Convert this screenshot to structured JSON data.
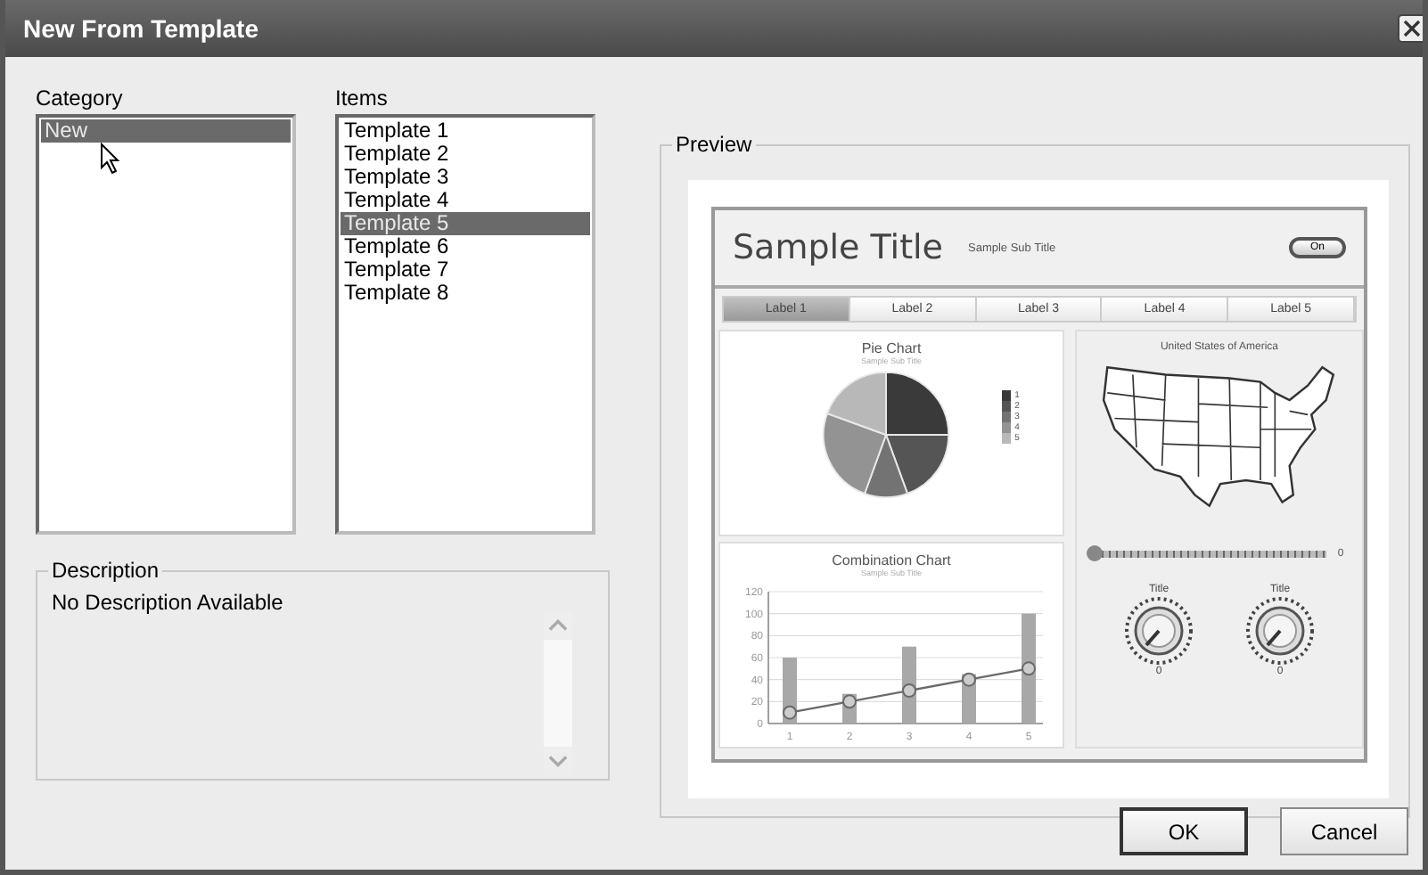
{
  "window": {
    "title": "New From Template"
  },
  "category": {
    "label": "Category",
    "items": [
      {
        "label": "New",
        "selected": true
      }
    ]
  },
  "items": {
    "label": "Items",
    "items": [
      {
        "label": "Template 1",
        "selected": false
      },
      {
        "label": "Template 2",
        "selected": false
      },
      {
        "label": "Template 3",
        "selected": false
      },
      {
        "label": "Template 4",
        "selected": false
      },
      {
        "label": "Template 5",
        "selected": true
      },
      {
        "label": "Template 6",
        "selected": false
      },
      {
        "label": "Template 7",
        "selected": false
      },
      {
        "label": "Template 8",
        "selected": false
      }
    ]
  },
  "description": {
    "label": "Description",
    "text": "No Description Available"
  },
  "preview": {
    "label": "Preview",
    "app": {
      "title": "Sample Title",
      "subtitle": "Sample Sub Title",
      "toggle": "On",
      "tabs": [
        {
          "label": "Label 1",
          "selected": true
        },
        {
          "label": "Label 2",
          "selected": false
        },
        {
          "label": "Label 3",
          "selected": false
        },
        {
          "label": "Label 4",
          "selected": false
        },
        {
          "label": "Label 5",
          "selected": false
        }
      ],
      "pie": {
        "title": "Pie Chart",
        "subtitle": "Sample Sub Title",
        "legend": [
          {
            "label": "1",
            "color": "#3a3a3a"
          },
          {
            "label": "2",
            "color": "#555555"
          },
          {
            "label": "3",
            "color": "#737373"
          },
          {
            "label": "4",
            "color": "#939393"
          },
          {
            "label": "5",
            "color": "#b8b8b8"
          }
        ]
      },
      "map": {
        "title": "United States of America"
      },
      "slider": {
        "level": 0,
        "reading": "0"
      },
      "combo": {
        "title": "Combination Chart",
        "subtitle": "Sample Sub Title",
        "chart_data": {
          "type": "bar",
          "categories": [
            "1",
            "2",
            "3",
            "4",
            "5"
          ],
          "series": [
            {
              "type": "bar",
              "color": "#a8a8a8",
              "values": [
                60,
                27,
                70,
                45,
                100
              ]
            },
            {
              "type": "line",
              "color": "#6a6a6a",
              "marker": "circle",
              "values": [
                10,
                20,
                30,
                40,
                50
              ]
            }
          ],
          "stacked": false,
          "grid": true,
          "ylim": [
            0,
            120
          ],
          "yticks": [
            0,
            20,
            40,
            60,
            80,
            100,
            120
          ]
        }
      },
      "gauges": [
        {
          "title": "Title",
          "reading": "0"
        },
        {
          "title": "Title",
          "reading": "0"
        }
      ]
    }
  },
  "buttons": [
    {
      "label": "OK",
      "default": true
    },
    {
      "label": "Cancel",
      "default": false
    }
  ]
}
